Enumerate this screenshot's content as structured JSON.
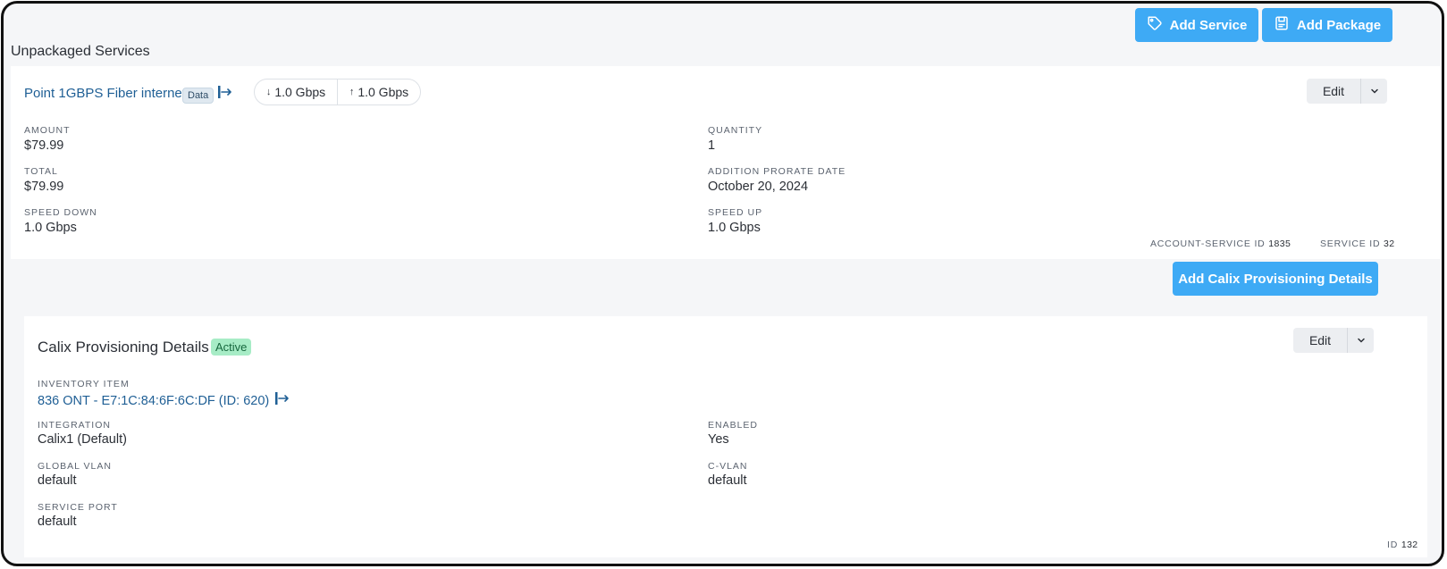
{
  "toolbar": {
    "add_service_label": "Add Service",
    "add_package_label": "Add Package"
  },
  "section_heading": "Unpackaged Services",
  "service": {
    "name": "Point 1GBPS Fiber internet",
    "type_badge": "Data",
    "speed_down": "1.0 Gbps",
    "speed_up": "1.0 Gbps",
    "edit_label": "Edit",
    "fields": {
      "amount_label": "AMOUNT",
      "amount": "$79.99",
      "quantity_label": "QUANTITY",
      "quantity": "1",
      "total_label": "TOTAL",
      "total": "$79.99",
      "addition_prorate_label": "ADDITION PRORATE DATE",
      "addition_prorate": "October 20, 2024",
      "speed_down_label": "SPEED DOWN",
      "speed_down": "1.0 Gbps",
      "speed_up_label": "SPEED UP",
      "speed_up": "1.0 Gbps"
    },
    "account_service_id_label": "ACCOUNT-SERVICE ID",
    "account_service_id": "1835",
    "service_id_label": "SERVICE ID",
    "service_id": "32"
  },
  "add_calix_label": "Add Calix Provisioning Details",
  "calix": {
    "title": "Calix Provisioning Details",
    "status_badge": "Active",
    "edit_label": "Edit",
    "inventory_item_label": "INVENTORY ITEM",
    "inventory_item": "836 ONT - E7:1C:84:6F:6C:DF (ID: 620)",
    "integration_label": "INTEGRATION",
    "integration": "Calix1 (Default)",
    "enabled_label": "ENABLED",
    "enabled": "Yes",
    "global_vlan_label": "GLOBAL VLAN",
    "global_vlan": "default",
    "c_vlan_label": "C-VLAN",
    "c_vlan": "default",
    "service_port_label": "SERVICE PORT",
    "service_port": "default",
    "id_label": "ID",
    "id": "132"
  },
  "colors": {
    "primary": "#3eaaf5",
    "link": "#1f5f95",
    "active_badge_bg": "#a7ecc6",
    "page_bg": "#f5f6f8"
  },
  "icons": {
    "add_service": "tag-icon",
    "add_package": "package-icon",
    "speed_down": "arrow-down-icon",
    "speed_up": "arrow-up-icon",
    "link": "external-link-icon",
    "dropdown": "chevron-down-icon"
  }
}
